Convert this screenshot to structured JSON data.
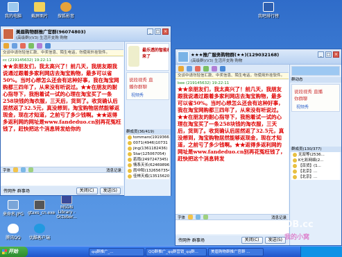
{
  "desktop_icons": [
    {
      "label": "我的电脑"
    },
    {
      "label": "截屏图片"
    },
    {
      "label": "搜狐影音"
    },
    {
      "label": "我吧排行榜"
    },
    {
      "label": "腾讯QQ"
    },
    {
      "label": "优酷客户端"
    },
    {
      "label": "来命名.JPG"
    },
    {
      "label": "gtaxs_cn.exe"
    },
    {
      "label": "MSDN Library - October..."
    }
  ],
  "window_left": {
    "title": "美眉购物群推广官群(96074803)",
    "subtitle": "(高级群)(V3) 生活开支购 购物",
    "notice": "交谈中请勿轻信汇款、中奖信息、陌生电话，勿使用外挂软件。",
    "meta": "cc (219145632)  19:22:11",
    "message": "★★亲朋友们，我太高兴了！前几天，我朋友跟我说通过跟着多家利网店去淘宝购物，最多可以省50%。当时心想怎么还会有这种好事，我在淘宝网购都三四年了，从来没有听说过。★★在朋友的耐心指导下，我抱着试一试的心理在淘宝买了一条258块钱的淘衣服，三天后，货到了。收货确认后居然返了32.5元，真没想到，淘宝购物居然能够返现金，现在才知道，之前亏了多少钱啊。★★返得多返利网的网址是",
    "url": "www.fandeduo.cn",
    "message_tail": "别再花冤枉钱了，赶快把这个消息转发给你的",
    "input_tool": "字体",
    "close_btn": "关闭(C)",
    "send_btn": "发送(S)",
    "msg_record": "消息记录",
    "bottom_left": "传网件 群事场",
    "ad_text": "最乐透的智能机来了",
    "video_label": "视频秀",
    "handwrite_label": "说段视秀 直播你群聊",
    "members_head": "群成员(36/419)",
    "members": [
      "tommaro(191936613)",
      "0071(4946)10731",
      "jing(1361182436)",
      "Star(125067054)",
      "若雨(2497247345)",
      "情系天长(624698969)",
      "雨中阳(1326567354)",
      "佳林天成(1351562045)"
    ]
  },
  "window_right": {
    "title": "★★★推广服务购物群(★★)(129032168)",
    "subtitle": "(高级群)(V3) 生活开支购 购物",
    "notice": "交谈中请勿轻信汇款、中奖信息、陌生电话，勿使用外挂软件。",
    "meta": "bee (219145632)  19:22:11",
    "message": "★★亲朋友们，我太高兴了！前几天，我朋友跟我说通过跟着多家利网店去淘宝购物，最多可以省50%。当时心想怎么还会有这种好事，我在淘宝网购都三四年了，从来没有听说过。★★在朋友的耐心指导下，我抱着试一试的心理在淘宝买了一条258块钱的淘衣服，三天后，货到了。收货确认后居然返了32.5元，真没想到，淘宝购物居然能够返现金，现在才知道，之前亏了多少钱啊。★★返得多返利网的网址是",
    "url": "www.fandeduo.cn",
    "message_tail": "别再花冤枉钱了，赶快把这个消息转发",
    "input_tool": "字体",
    "close_btn": "关闭(C)",
    "send_btn": "发送(S)",
    "msg_record": "消息记录",
    "bottom_left": "传网件 群事场",
    "group_label": "群动态",
    "video_label": "视频秀",
    "handwrite_label": "说段视秀 直播你群聊",
    "members_head": "群成员(130/377)",
    "members": [
      "无双等(2536...",
      "K七彩网络(2...",
      "【百货】(1...",
      "【北京】...",
      "【北京】..."
    ]
  },
  "taskbar": {
    "start_label": "开始",
    "tasks": [
      "qq群推广_...",
      "QQ群推广_qq群营销_qq群...",
      "美眉购物群推广官群 ..."
    ],
    "clock": ""
  },
  "watermark": "LUOB.cc",
  "watermark_sub": "我的小窝"
}
